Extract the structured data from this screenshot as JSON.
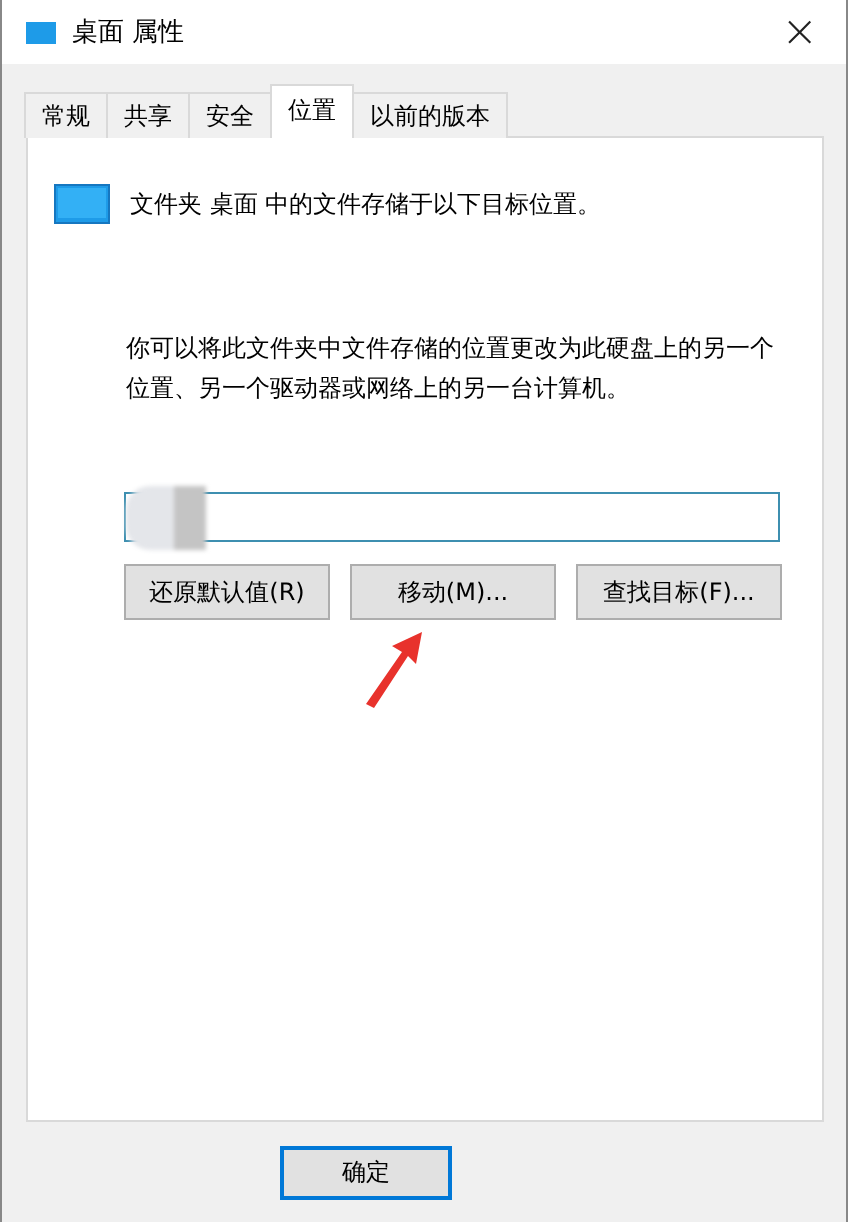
{
  "window": {
    "title": "桌面 属性",
    "close": "×"
  },
  "tabs": [
    {
      "label": "常规",
      "selected": false
    },
    {
      "label": "共享",
      "selected": false
    },
    {
      "label": "安全",
      "selected": false
    },
    {
      "label": "位置",
      "selected": true
    },
    {
      "label": "以前的版本",
      "selected": false
    }
  ],
  "location": {
    "header": "文件夹 桌面 中的文件存储于以下目标位置。",
    "description": "你可以将此文件夹中文件存储的位置更改为此硬盘上的另一个位置、另一个驱动器或网络上的另一台计算机。",
    "path": {
      "blurred": true
    },
    "buttons": [
      {
        "label": "还原默认值(R)"
      },
      {
        "label": "移动(M)..."
      },
      {
        "label": "查找目标(F)..."
      }
    ],
    "annotation": {
      "kind": "arrow"
    }
  },
  "footer": {
    "buttons": [
      {
        "label": "确定",
        "default": true
      }
    ]
  }
}
